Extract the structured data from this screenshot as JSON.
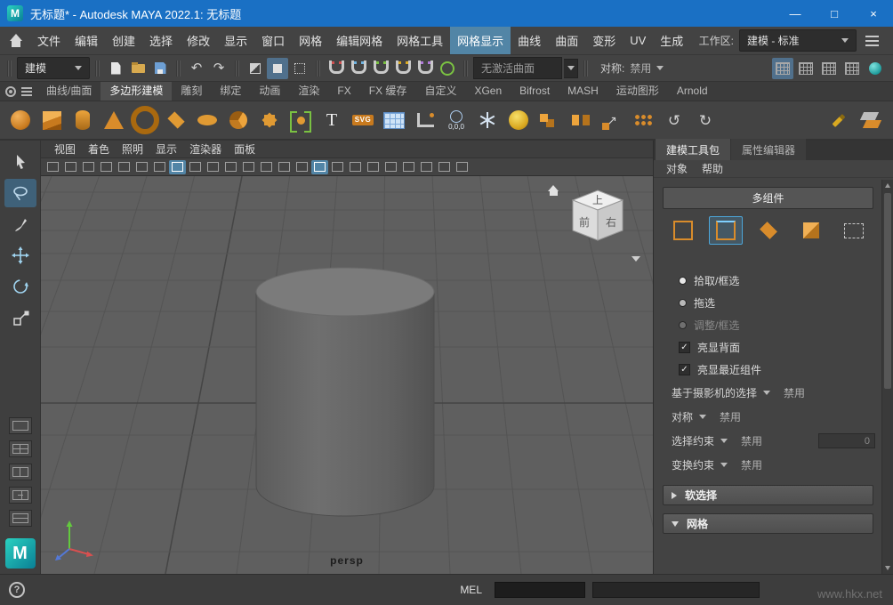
{
  "logo": {
    "letter": "M"
  },
  "titlebar": {
    "title": "无标题* - Autodesk MAYA 2022.1: 无标题",
    "minimize": "—",
    "maximize": "□",
    "close": "×"
  },
  "menubar": {
    "items": [
      {
        "label": "文件"
      },
      {
        "label": "编辑"
      },
      {
        "label": "创建"
      },
      {
        "label": "选择"
      },
      {
        "label": "修改"
      },
      {
        "label": "显示"
      },
      {
        "label": "窗口"
      },
      {
        "label": "网格"
      },
      {
        "label": "编辑网格"
      },
      {
        "label": "网格工具"
      },
      {
        "label": "网格显示",
        "cls": "active"
      },
      {
        "label": "曲线"
      },
      {
        "label": "曲面"
      },
      {
        "label": "变形"
      },
      {
        "label": "UV"
      },
      {
        "label": "生成"
      }
    ],
    "workspace_label": "工作区:",
    "workspace_value": "建模 - 标准"
  },
  "toolbar": {
    "mode_selector": "建模",
    "file_icons": [
      {
        "name": "new-scene-icon",
        "cls": "t-page"
      },
      {
        "name": "open-scene-icon",
        "cls": "t-folder"
      },
      {
        "name": "save-scene-icon",
        "cls": "t-floppy"
      }
    ],
    "history_icons": [
      {
        "name": "undo-icon",
        "cls": "t-glyph",
        "glyph": "↶"
      },
      {
        "name": "redo-icon",
        "cls": "t-glyph",
        "glyph": "↷"
      }
    ],
    "mask_icons": [
      {
        "name": "select-hierarchy-icon",
        "cls": "t-mask1"
      },
      {
        "name": "select-object-icon",
        "cls": "t-mask2 active"
      },
      {
        "name": "select-component-icon",
        "cls": "t-mask3"
      }
    ],
    "snap_icons": [
      {
        "name": "snap-to-grid-icon",
        "cls": "t-magnet c1"
      },
      {
        "name": "snap-to-curve-icon",
        "cls": "t-magnet c2"
      },
      {
        "name": "snap-to-point-icon",
        "cls": "t-magnet c3"
      },
      {
        "name": "snap-to-projected-center-icon",
        "cls": "t-magnet c4"
      },
      {
        "name": "snap-to-view-plane-icon",
        "cls": "t-magnet c5"
      },
      {
        "name": "make-live-icon",
        "cls": "t-live"
      }
    ],
    "no_active_surface": "无激活曲面",
    "symmetry_label": "对称:",
    "symmetry_value": "禁用",
    "right_icons": [
      {
        "name": "modeling-toolkit-toggle-icon",
        "cls": "t-grid active"
      },
      {
        "name": "channel-box-toggle-icon",
        "cls": "t-grid"
      },
      {
        "name": "attribute-editor-toggle-icon",
        "cls": "t-grid"
      },
      {
        "name": "tool-settings-toggle-icon",
        "cls": "t-grid"
      },
      {
        "name": "hypershade-icon",
        "cls": "t-ball"
      }
    ]
  },
  "shelf": {
    "tabs": [
      {
        "label": "曲线/曲面"
      },
      {
        "label": "多边形建模",
        "cls": "active"
      },
      {
        "label": "雕刻"
      },
      {
        "label": "绑定"
      },
      {
        "label": "动画"
      },
      {
        "label": "渲染"
      },
      {
        "label": "FX"
      },
      {
        "label": "FX 缓存"
      },
      {
        "label": "自定义"
      },
      {
        "label": "XGen"
      },
      {
        "label": "Bifrost"
      },
      {
        "label": "MASH"
      },
      {
        "label": "运动图形"
      },
      {
        "label": "Arnold"
      }
    ],
    "icons": [
      {
        "name": "poly-sphere-icon",
        "cls": "i-sphere"
      },
      {
        "name": "poly-cube-icon",
        "cls": "i-cube"
      },
      {
        "name": "poly-cylinder-icon",
        "cls": "i-cylinder"
      },
      {
        "name": "poly-cone-icon",
        "cls": "i-cone"
      },
      {
        "name": "poly-torus-icon",
        "cls": "i-torus"
      },
      {
        "name": "poly-plane-icon",
        "cls": "i-plane"
      },
      {
        "name": "poly-disc-icon",
        "cls": "i-disc"
      },
      {
        "name": "platonic-solid-icon",
        "cls": "i-platonic"
      },
      {
        "name": "sweep-mesh-icon",
        "cls": "i-star"
      },
      {
        "name": "curve-instance-icon",
        "cls": "i-brackets"
      },
      {
        "name": "type-tool-icon",
        "cls": "i-type",
        "glyph": "T"
      },
      {
        "name": "svg-tool-icon",
        "cls": "i-svg",
        "glyph": "SVG"
      },
      {
        "name": "node-table-icon",
        "cls": "i-table"
      },
      {
        "name": "measure-tool-icon",
        "cls": "i-measure"
      },
      {
        "name": "move-to-origin-icon",
        "cls": "i-origin",
        "glyph": "0,0,0"
      },
      {
        "name": "freeze-transform-icon",
        "cls": "i-snow"
      },
      {
        "name": "smooth-mesh-icon",
        "cls": "i-smooth"
      },
      {
        "name": "combine-icon",
        "cls": "i-combine"
      },
      {
        "name": "separate-icon",
        "cls": "i-separate"
      },
      {
        "name": "extract-face-icon",
        "cls": "i-extract",
        "glyph": "↗"
      },
      {
        "name": "duplicate-face-icon",
        "cls": "i-dup"
      },
      {
        "name": "mirror-geometry-icon",
        "cls": "i-mirror",
        "glyph": "↺"
      },
      {
        "name": "flip-geometry-icon",
        "cls": "i-flip",
        "glyph": "↻"
      }
    ],
    "right_icons": [
      {
        "name": "quad-draw-icon",
        "cls": "i-quaddraw"
      },
      {
        "name": "multi-cut-icon",
        "cls": "i-multicut"
      }
    ]
  },
  "viewport": {
    "menus": [
      {
        "label": "视图"
      },
      {
        "label": "着色"
      },
      {
        "label": "照明"
      },
      {
        "label": "显示"
      },
      {
        "label": "渲染器"
      },
      {
        "label": "面板"
      }
    ],
    "toolbar_icons": [
      {
        "name": "select-camera-icon"
      },
      {
        "name": "lock-camera-icon"
      },
      {
        "name": "camera-attributes-icon"
      },
      {
        "name": "bookmarks-icon"
      },
      {
        "name": "image-plane-icon"
      },
      {
        "name": "2d-pan-zoom-icon"
      },
      {
        "name": "grease-pencil-icon"
      },
      {
        "name": "grid-toggle-icon",
        "cls": "active"
      },
      {
        "name": "film-gate-icon"
      },
      {
        "name": "resolution-gate-icon"
      },
      {
        "name": "gate-mask-icon"
      },
      {
        "name": "field-chart-icon"
      },
      {
        "name": "safe-action-icon"
      },
      {
        "name": "safe-title-icon"
      },
      {
        "name": "wireframe-icon"
      },
      {
        "name": "smooth-shade-icon",
        "cls": "active"
      },
      {
        "name": "textured-icon"
      },
      {
        "name": "use-default-material-icon"
      },
      {
        "name": "wireframe-on-shaded-icon"
      },
      {
        "name": "lighting-icon"
      },
      {
        "name": "shadows-icon"
      },
      {
        "name": "screen-space-ao-icon"
      },
      {
        "name": "motion-blur-icon"
      },
      {
        "name": "isolate-select-icon"
      }
    ],
    "camera_label": "persp",
    "viewcube": {
      "top": "上",
      "front": "前",
      "right": "右"
    }
  },
  "right_panel": {
    "tabs": [
      {
        "label": "建模工具包",
        "cls": "active"
      },
      {
        "label": "属性编辑器"
      }
    ],
    "menus": [
      {
        "label": "对象"
      },
      {
        "label": "帮助"
      }
    ],
    "multi_component_label": "多组件",
    "component_icons": [
      {
        "name": "vertex-mode-icon",
        "cls": "c-vertex"
      },
      {
        "name": "edge-mode-icon",
        "cls": "c-edge active"
      },
      {
        "name": "face-mode-icon",
        "cls": "c-face"
      },
      {
        "name": "uv-mode-icon",
        "cls": "c-uv"
      },
      {
        "name": "object-mode-icon",
        "cls": "c-multi"
      }
    ],
    "radio_options": [
      {
        "label": "拾取/框选",
        "cls": "checked"
      },
      {
        "label": "拖选"
      },
      {
        "label": "调整/框选",
        "cls": "disabled"
      }
    ],
    "checkboxes": [
      {
        "label": "亮显背面",
        "check": "✓"
      },
      {
        "label": "亮显最近组件",
        "check": "✓"
      }
    ],
    "dropdown_rows": [
      {
        "label": "基于摄影机的选择",
        "value": "禁用"
      },
      {
        "label": "对称",
        "value": "禁用"
      },
      {
        "label": "选择约束",
        "value": "禁用",
        "field": "0"
      },
      {
        "label": "变换约束",
        "value": "禁用"
      }
    ],
    "sections": [
      {
        "label": "软选择",
        "cls": "collapsed"
      },
      {
        "label": "网格"
      }
    ]
  },
  "bottombar": {
    "help": "?",
    "mel_label": "MEL",
    "watermark": "www.hkx.net"
  }
}
